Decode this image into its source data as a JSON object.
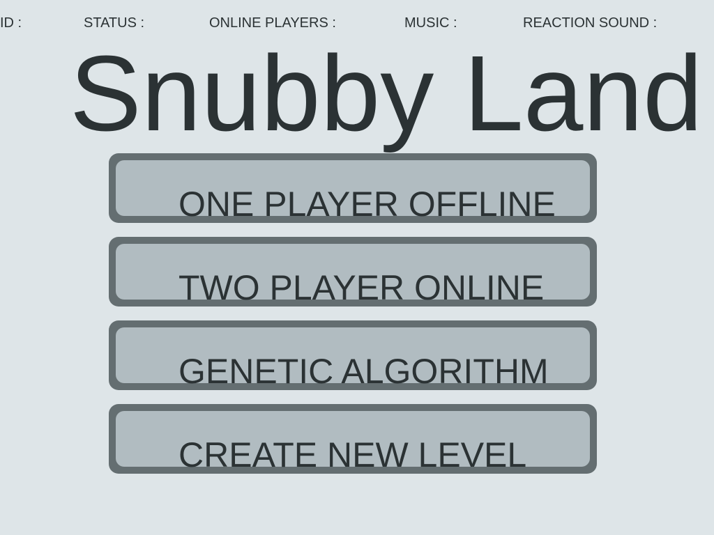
{
  "status_bar": {
    "id_label": "ID :",
    "status_label": "STATUS :",
    "online_players_label": "ONLINE PLAYERS :",
    "music_label": "MUSIC :",
    "reaction_sound_label": "REACTION SOUND :"
  },
  "title": "Snubby Land",
  "menu": {
    "buttons": [
      {
        "label": "ONE PLAYER OFFLINE"
      },
      {
        "label": "TWO PLAYER ONLINE"
      },
      {
        "label": "GENETIC ALGORITHM"
      },
      {
        "label": "CREATE NEW LEVEL"
      }
    ]
  },
  "colors": {
    "background": "#dee5e8",
    "text": "#2b3234",
    "button_border": "#646e71",
    "button_fill": "#b1bcc1"
  }
}
